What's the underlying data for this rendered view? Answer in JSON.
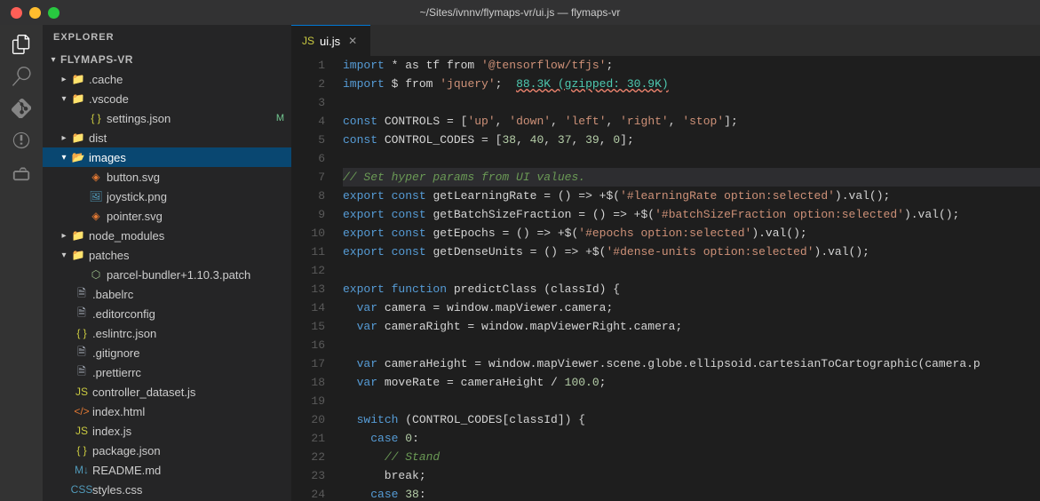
{
  "titlebar": {
    "title": "~/Sites/ivnnv/flymaps-vr/ui.js — flymaps-vr",
    "buttons": [
      "close",
      "minimize",
      "maximize"
    ]
  },
  "sidebar": {
    "header": "EXPLORER",
    "project": "FLYMAPS-VR",
    "items": [
      {
        "id": "cache",
        "label": ".cache",
        "type": "folder",
        "depth": 0,
        "collapsed": true
      },
      {
        "id": "vscode",
        "label": ".vscode",
        "type": "folder",
        "depth": 0,
        "collapsed": false
      },
      {
        "id": "settings",
        "label": "settings.json",
        "type": "json",
        "depth": 1,
        "badge": "M"
      },
      {
        "id": "dist",
        "label": "dist",
        "type": "folder",
        "depth": 0,
        "collapsed": true
      },
      {
        "id": "images",
        "label": "images",
        "type": "folder-open",
        "depth": 0,
        "collapsed": false,
        "active": true
      },
      {
        "id": "button-svg",
        "label": "button.svg",
        "type": "svg",
        "depth": 1
      },
      {
        "id": "joystick-png",
        "label": "joystick.png",
        "type": "png",
        "depth": 1
      },
      {
        "id": "pointer-svg",
        "label": "pointer.svg",
        "type": "svg",
        "depth": 1
      },
      {
        "id": "node_modules",
        "label": "node_modules",
        "type": "folder",
        "depth": 0,
        "collapsed": true
      },
      {
        "id": "patches",
        "label": "patches",
        "type": "folder",
        "depth": 0,
        "collapsed": false
      },
      {
        "id": "parcel-patch",
        "label": "parcel-bundler+1.10.3.patch",
        "type": "patch",
        "depth": 1
      },
      {
        "id": "babelrc",
        "label": ".babelrc",
        "type": "file",
        "depth": 0
      },
      {
        "id": "editorconfig",
        "label": ".editorconfig",
        "type": "file",
        "depth": 0
      },
      {
        "id": "eslintrc",
        "label": ".eslintrc.json",
        "type": "json",
        "depth": 0
      },
      {
        "id": "gitignore",
        "label": ".gitignore",
        "type": "file",
        "depth": 0
      },
      {
        "id": "prettierrc",
        "label": ".prettierrc",
        "type": "file",
        "depth": 0
      },
      {
        "id": "controller",
        "label": "controller_dataset.js",
        "type": "js",
        "depth": 0
      },
      {
        "id": "index-html",
        "label": "index.html",
        "type": "html",
        "depth": 0
      },
      {
        "id": "index-js",
        "label": "index.js",
        "type": "js",
        "depth": 0
      },
      {
        "id": "package-json",
        "label": "package.json",
        "type": "json",
        "depth": 0
      },
      {
        "id": "readme",
        "label": "README.md",
        "type": "md",
        "depth": 0
      },
      {
        "id": "styles-css",
        "label": "styles.css",
        "type": "css",
        "depth": 0
      }
    ]
  },
  "tab": {
    "filename": "ui.js",
    "icon": "js"
  },
  "editor": {
    "lines": [
      {
        "num": 1,
        "tokens": [
          {
            "text": "import",
            "cls": "c-keyword"
          },
          {
            "text": " * as tf from ",
            "cls": "c-plain"
          },
          {
            "text": "'@tensorflow/tfjs'",
            "cls": "c-string"
          },
          {
            "text": ";",
            "cls": "c-plain"
          }
        ]
      },
      {
        "num": 2,
        "tokens": [
          {
            "text": "import",
            "cls": "c-keyword"
          },
          {
            "text": " $ from ",
            "cls": "c-plain"
          },
          {
            "text": "'jquery'",
            "cls": "c-string"
          },
          {
            "text": ";  ",
            "cls": "c-plain"
          },
          {
            "text": "88.3K (gzipped: 30.9K)",
            "cls": "c-size"
          }
        ]
      },
      {
        "num": 3,
        "tokens": []
      },
      {
        "num": 4,
        "tokens": [
          {
            "text": "const",
            "cls": "c-keyword"
          },
          {
            "text": " CONTROLS = [",
            "cls": "c-plain"
          },
          {
            "text": "'up'",
            "cls": "c-string"
          },
          {
            "text": ", ",
            "cls": "c-plain"
          },
          {
            "text": "'down'",
            "cls": "c-string"
          },
          {
            "text": ", ",
            "cls": "c-plain"
          },
          {
            "text": "'left'",
            "cls": "c-string"
          },
          {
            "text": ", ",
            "cls": "c-plain"
          },
          {
            "text": "'right'",
            "cls": "c-string"
          },
          {
            "text": ", ",
            "cls": "c-plain"
          },
          {
            "text": "'stop'",
            "cls": "c-string"
          },
          {
            "text": "];",
            "cls": "c-plain"
          }
        ]
      },
      {
        "num": 5,
        "tokens": [
          {
            "text": "const",
            "cls": "c-keyword"
          },
          {
            "text": " CONTROL_CODES = [",
            "cls": "c-plain"
          },
          {
            "text": "38",
            "cls": "c-number"
          },
          {
            "text": ", ",
            "cls": "c-plain"
          },
          {
            "text": "40",
            "cls": "c-number"
          },
          {
            "text": ", ",
            "cls": "c-plain"
          },
          {
            "text": "37",
            "cls": "c-number"
          },
          {
            "text": ", ",
            "cls": "c-plain"
          },
          {
            "text": "39",
            "cls": "c-number"
          },
          {
            "text": ", ",
            "cls": "c-plain"
          },
          {
            "text": "0",
            "cls": "c-number"
          },
          {
            "text": "];",
            "cls": "c-plain"
          }
        ]
      },
      {
        "num": 6,
        "tokens": []
      },
      {
        "num": 7,
        "tokens": [
          {
            "text": "// Set hyper params from UI values.",
            "cls": "c-comment"
          }
        ]
      },
      {
        "num": 8,
        "tokens": [
          {
            "text": "export",
            "cls": "c-keyword"
          },
          {
            "text": " ",
            "cls": "c-plain"
          },
          {
            "text": "const",
            "cls": "c-keyword"
          },
          {
            "text": " getLearningRate = () => +$(",
            "cls": "c-plain"
          },
          {
            "text": "'#learningRate option:selected'",
            "cls": "c-string"
          },
          {
            "text": ").val();",
            "cls": "c-plain"
          }
        ]
      },
      {
        "num": 9,
        "tokens": [
          {
            "text": "export",
            "cls": "c-keyword"
          },
          {
            "text": " ",
            "cls": "c-plain"
          },
          {
            "text": "const",
            "cls": "c-keyword"
          },
          {
            "text": " getBatchSizeFraction = () => +$(",
            "cls": "c-plain"
          },
          {
            "text": "'#batchSizeFraction option:selected'",
            "cls": "c-string"
          },
          {
            "text": ").val();",
            "cls": "c-plain"
          }
        ]
      },
      {
        "num": 10,
        "tokens": [
          {
            "text": "export",
            "cls": "c-keyword"
          },
          {
            "text": " ",
            "cls": "c-plain"
          },
          {
            "text": "const",
            "cls": "c-keyword"
          },
          {
            "text": " getEpochs = () => +$(",
            "cls": "c-plain"
          },
          {
            "text": "'#epochs option:selected'",
            "cls": "c-string"
          },
          {
            "text": ").val();",
            "cls": "c-plain"
          }
        ]
      },
      {
        "num": 11,
        "tokens": [
          {
            "text": "export",
            "cls": "c-keyword"
          },
          {
            "text": " ",
            "cls": "c-plain"
          },
          {
            "text": "const",
            "cls": "c-keyword"
          },
          {
            "text": " getDenseUnits = () => +$(",
            "cls": "c-plain"
          },
          {
            "text": "'#dense-units option:selected'",
            "cls": "c-string"
          },
          {
            "text": ").val();",
            "cls": "c-plain"
          }
        ]
      },
      {
        "num": 12,
        "tokens": []
      },
      {
        "num": 13,
        "tokens": [
          {
            "text": "export",
            "cls": "c-keyword"
          },
          {
            "text": " ",
            "cls": "c-plain"
          },
          {
            "text": "function",
            "cls": "c-keyword"
          },
          {
            "text": " predictClass (classId) {",
            "cls": "c-plain"
          }
        ]
      },
      {
        "num": 14,
        "tokens": [
          {
            "text": "  var",
            "cls": "c-keyword"
          },
          {
            "text": " camera = window.mapViewer.camera;",
            "cls": "c-plain"
          }
        ]
      },
      {
        "num": 15,
        "tokens": [
          {
            "text": "  var",
            "cls": "c-keyword"
          },
          {
            "text": " cameraRight = window.mapViewerRight.camera;",
            "cls": "c-plain"
          }
        ]
      },
      {
        "num": 16,
        "tokens": []
      },
      {
        "num": 17,
        "tokens": [
          {
            "text": "  var",
            "cls": "c-keyword"
          },
          {
            "text": " cameraHeight = window.mapViewer.scene.globe.ellipsoid.cartesianToCartographic(camera.p",
            "cls": "c-plain"
          }
        ]
      },
      {
        "num": 18,
        "tokens": [
          {
            "text": "  var",
            "cls": "c-keyword"
          },
          {
            "text": " moveRate = cameraHeight / ",
            "cls": "c-plain"
          },
          {
            "text": "100.0",
            "cls": "c-number"
          },
          {
            "text": ";",
            "cls": "c-plain"
          }
        ]
      },
      {
        "num": 19,
        "tokens": []
      },
      {
        "num": 20,
        "tokens": [
          {
            "text": "  switch",
            "cls": "c-keyword"
          },
          {
            "text": " (CONTROL_CODES[classId]) {",
            "cls": "c-plain"
          }
        ]
      },
      {
        "num": 21,
        "tokens": [
          {
            "text": "    case",
            "cls": "c-keyword"
          },
          {
            "text": " ",
            "cls": "c-plain"
          },
          {
            "text": "0",
            "cls": "c-number"
          },
          {
            "text": ":",
            "cls": "c-plain"
          }
        ]
      },
      {
        "num": 22,
        "tokens": [
          {
            "text": "      ",
            "cls": "c-plain"
          },
          {
            "text": "// Stand",
            "cls": "c-comment"
          }
        ]
      },
      {
        "num": 23,
        "tokens": [
          {
            "text": "      break;",
            "cls": "c-plain"
          }
        ]
      },
      {
        "num": 24,
        "tokens": [
          {
            "text": "    case",
            "cls": "c-keyword"
          },
          {
            "text": " ",
            "cls": "c-plain"
          },
          {
            "text": "38",
            "cls": "c-number"
          },
          {
            "text": ":",
            "cls": "c-plain"
          }
        ]
      }
    ]
  }
}
